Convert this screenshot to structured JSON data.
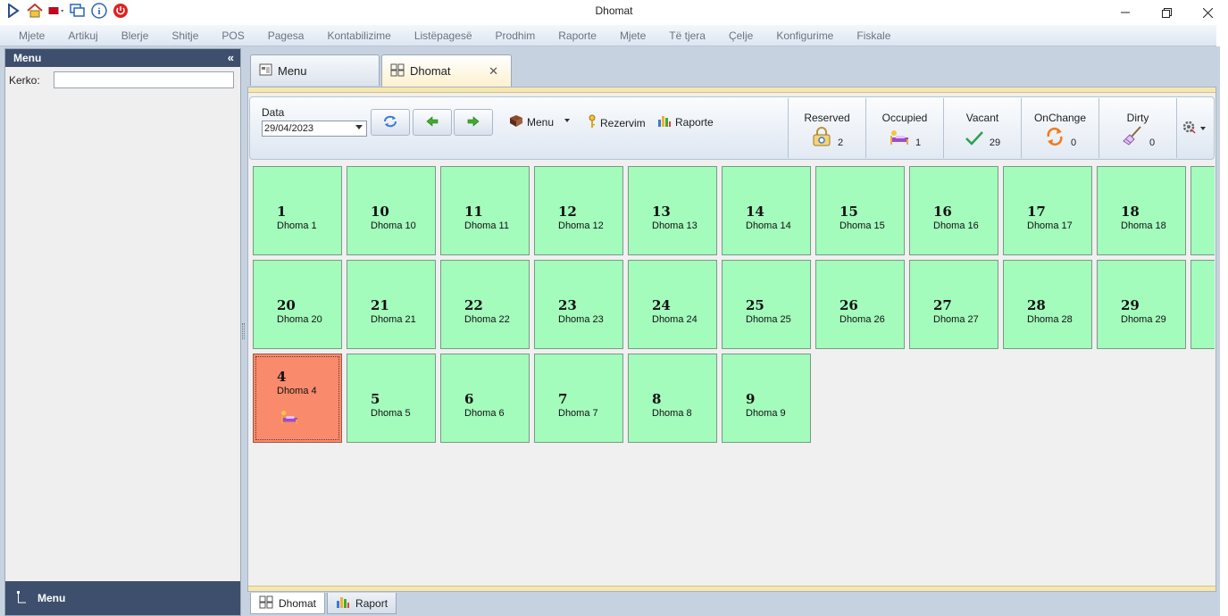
{
  "window": {
    "title": "Dhomat",
    "controls": [
      "minimize-icon",
      "restore-icon",
      "close-icon"
    ]
  },
  "quick_access": [
    "play-icon",
    "home-icon",
    "flag-icon",
    "windows-icon",
    "info-icon",
    "power-icon"
  ],
  "menubar": [
    "Mjete",
    "Artikuj",
    "Blerje",
    "Shitje",
    "POS",
    "Pagesa",
    "Kontabilizime",
    "Listëpagesë",
    "Prodhim",
    "Raporte",
    "Mjete",
    "Të tjera",
    "Çelje",
    "Konfigurime",
    "Fiskale"
  ],
  "left_panel": {
    "title": "Menu",
    "search_label": "Kerko:",
    "search_value": "",
    "footer_label": "Menu"
  },
  "tabs": [
    {
      "label": "Menu",
      "icon": "window-icon",
      "active": false
    },
    {
      "label": "Dhomat",
      "icon": "rooms-icon",
      "active": true
    }
  ],
  "toolbar": {
    "date_label": "Data",
    "date_value": "29/04/2023",
    "menu_label": "Menu",
    "rezervim_label": "Rezervim",
    "raporte_label": "Raporte"
  },
  "stats": [
    {
      "label": "Reserved",
      "count": "2",
      "icon": "lock-icon"
    },
    {
      "label": "Occupied",
      "count": "1",
      "icon": "bed-icon"
    },
    {
      "label": "Vacant",
      "count": "29",
      "icon": "check-icon"
    },
    {
      "label": "OnChange",
      "count": "0",
      "icon": "refresh-icon"
    },
    {
      "label": "Dirty",
      "count": "0",
      "icon": "broom-icon"
    }
  ],
  "rooms": [
    {
      "num": "1",
      "name": "Dhoma 1",
      "status": "vacant"
    },
    {
      "num": "10",
      "name": "Dhoma 10",
      "status": "vacant"
    },
    {
      "num": "11",
      "name": "Dhoma 11",
      "status": "vacant"
    },
    {
      "num": "12",
      "name": "Dhoma 12",
      "status": "vacant"
    },
    {
      "num": "13",
      "name": "Dhoma 13",
      "status": "vacant"
    },
    {
      "num": "14",
      "name": "Dhoma 14",
      "status": "vacant"
    },
    {
      "num": "15",
      "name": "Dhoma 15",
      "status": "vacant"
    },
    {
      "num": "16",
      "name": "Dhoma 16",
      "status": "vacant"
    },
    {
      "num": "17",
      "name": "Dhoma 17",
      "status": "vacant"
    },
    {
      "num": "18",
      "name": "Dhoma 18",
      "status": "vacant"
    },
    {
      "num": "20",
      "name": "Dhoma 20",
      "status": "vacant"
    },
    {
      "num": "21",
      "name": "Dhoma 21",
      "status": "vacant"
    },
    {
      "num": "22",
      "name": "Dhoma 22",
      "status": "vacant"
    },
    {
      "num": "23",
      "name": "Dhoma 23",
      "status": "vacant"
    },
    {
      "num": "24",
      "name": "Dhoma 24",
      "status": "vacant"
    },
    {
      "num": "25",
      "name": "Dhoma 25",
      "status": "vacant"
    },
    {
      "num": "26",
      "name": "Dhoma 26",
      "status": "vacant"
    },
    {
      "num": "27",
      "name": "Dhoma 27",
      "status": "vacant"
    },
    {
      "num": "28",
      "name": "Dhoma 28",
      "status": "vacant"
    },
    {
      "num": "29",
      "name": "Dhoma 29",
      "status": "vacant"
    },
    {
      "num": "4",
      "name": "Dhoma 4",
      "status": "occupied"
    },
    {
      "num": "5",
      "name": "Dhoma 5",
      "status": "vacant"
    },
    {
      "num": "6",
      "name": "Dhoma 6",
      "status": "vacant"
    },
    {
      "num": "7",
      "name": "Dhoma 7",
      "status": "vacant"
    },
    {
      "num": "8",
      "name": "Dhoma 8",
      "status": "vacant"
    },
    {
      "num": "9",
      "name": "Dhoma 9",
      "status": "vacant"
    }
  ],
  "bottom_tabs": [
    {
      "label": "Dhomat",
      "icon": "rooms-icon",
      "active": true
    },
    {
      "label": "Raport",
      "icon": "chart-icon",
      "active": false
    }
  ],
  "colors": {
    "vacant": "#a3fbbc",
    "occupied": "#f98a6c",
    "panel_header": "#3d4f6c"
  }
}
